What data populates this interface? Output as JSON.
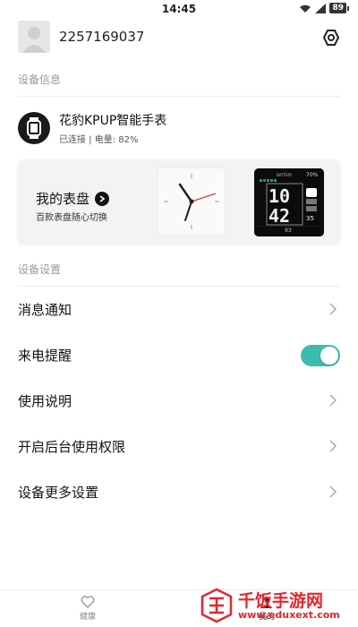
{
  "status_bar": {
    "time": "14:45",
    "battery": "89"
  },
  "profile": {
    "user_id": "2257169037"
  },
  "sections": {
    "device_info": "设备信息",
    "device_settings": "设备设置"
  },
  "device": {
    "name": "花豹KPUP智能手表",
    "status": "已连接 | 电量: 82%"
  },
  "watch_face_card": {
    "title": "我的表盘",
    "subtitle": "百款表盘随心切换",
    "digital_face": {
      "hours": "10",
      "minutes": "42",
      "battery_percent": "70%",
      "battery_label": "BATTERY",
      "steps": "93",
      "small_num": "35"
    }
  },
  "menu": [
    {
      "label": "消息通知",
      "control": "chevron"
    },
    {
      "label": "来电提醒",
      "control": "toggle",
      "on": true
    },
    {
      "label": "使用说明",
      "control": "chevron"
    },
    {
      "label": "开启后台使用权限",
      "control": "chevron"
    },
    {
      "label": "设备更多设置",
      "control": "chevron"
    }
  ],
  "tabbar": {
    "health": "健康",
    "mine": "我的"
  },
  "watermark": {
    "title": "千饭手游网",
    "url": "www.eduxext.com",
    "logo_text": "饭"
  },
  "colors": {
    "toggle_on": "#3cbcb0",
    "watermark_red": "#e8242a"
  }
}
